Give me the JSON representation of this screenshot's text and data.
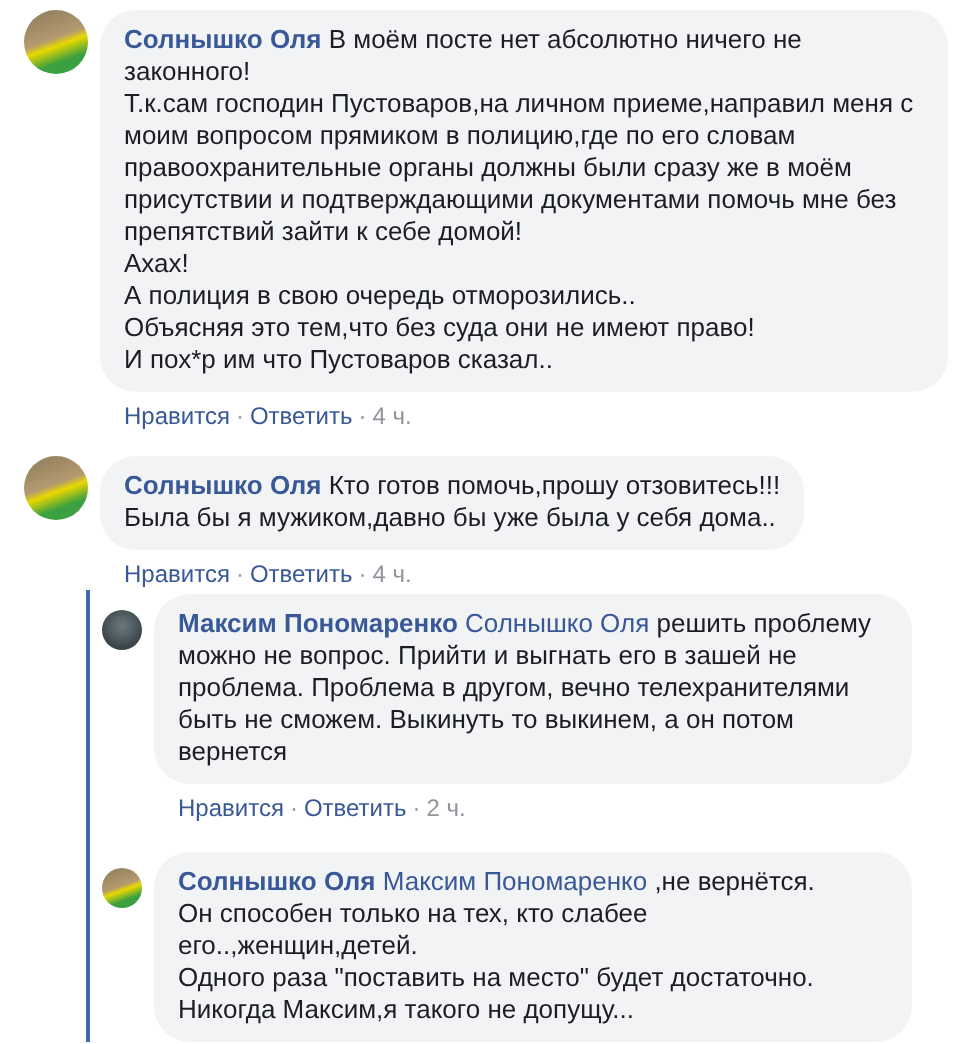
{
  "comments": [
    {
      "author": "Солнышко Оля",
      "paragraphs": [
        "В моём посте нет абсолютно ничего не законного!",
        "Т.к.сам господин Пустоваров,на личном приеме,направил меня с моим вопросом прямиком в полицию,где по его словам правоохранительные органы должны были сразу же в моём присутствии и подтверждающими документами помочь мне без препятствий зайти к себе домой!",
        "Ахах!",
        "А полиция в свою очередь отморозились..",
        "Объясняя это тем,что без суда они не имеют право!",
        "И пох*р им что Пустоваров сказал.."
      ],
      "actions": {
        "like": "Нравится",
        "reply": "Ответить",
        "time": "4 ч.",
        "separator": "·"
      }
    },
    {
      "author": "Солнышко Оля",
      "paragraphs": [
        "Кто готов помочь,прошу отзовитесь!!!",
        "Была бы я мужиком,давно бы уже была у себя дома.."
      ],
      "actions": {
        "like": "Нравится",
        "reply": "Ответить",
        "time": "4 ч.",
        "separator": "·"
      },
      "replies": [
        {
          "author": "Максим Пономаренко",
          "mention": "Солнышко Оля",
          "paragraphs": [
            "решить проблему можно не вопрос. Прийти и выгнать его в зашей не проблема. Проблема в другом, вечно телехранителями быть не сможем. Выкинуть то выкинем, а он потом вернется"
          ],
          "actions": {
            "like": "Нравится",
            "reply": "Ответить",
            "time": "2 ч.",
            "separator": "·"
          }
        },
        {
          "author": "Солнышко Оля",
          "mention": "Максим Пономаренко",
          "paragraphs": [
            ",не вернётся.",
            "Он способен только на тех, кто слабее его..,женщин,детей.",
            "Одного раза \"поставить на место\" будет достаточно.",
            "Никогда Максим,я такого не допущу..."
          ]
        }
      ]
    }
  ]
}
